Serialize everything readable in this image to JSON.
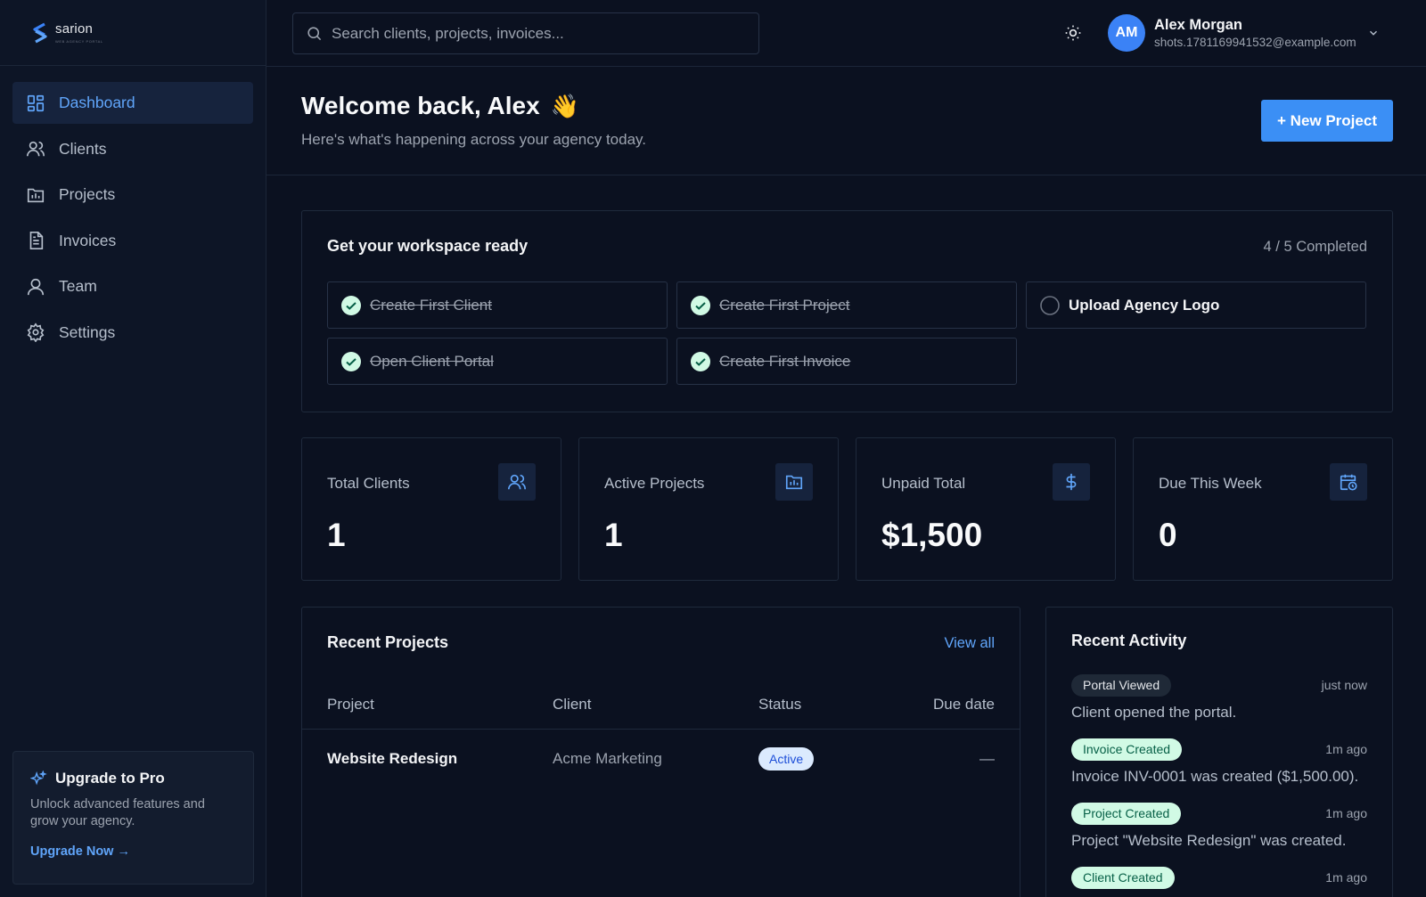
{
  "brand": {
    "name": "sarion",
    "tagline": "WEB AGENCY PORTAL",
    "accent": "#3b82f6"
  },
  "sidebar": {
    "items": [
      {
        "label": "Dashboard",
        "icon": "dashboard-icon",
        "active": true
      },
      {
        "label": "Clients",
        "icon": "users-icon"
      },
      {
        "label": "Projects",
        "icon": "folder-icon"
      },
      {
        "label": "Invoices",
        "icon": "file-text-icon"
      },
      {
        "label": "Team",
        "icon": "user-icon"
      },
      {
        "label": "Settings",
        "icon": "gear-icon"
      }
    ],
    "upgrade": {
      "title": "Upgrade to Pro",
      "description": "Unlock advanced features and grow your agency.",
      "link": "Upgrade Now →"
    }
  },
  "topbar": {
    "search_placeholder": "Search clients, projects, invoices...",
    "user": {
      "initials": "AM",
      "name": "Alex Morgan",
      "email": "shots.1781169941532@example.com"
    }
  },
  "header": {
    "title": "Welcome back, Alex",
    "emoji": "👋",
    "subtitle": "Here's what's happening across your agency today.",
    "new_project_label": "+ New Project"
  },
  "workspace": {
    "title": "Get your workspace ready",
    "progress": "4 / 5 Completed",
    "tasks": [
      {
        "label": "Create First Client",
        "done": true
      },
      {
        "label": "Create First Project",
        "done": true
      },
      {
        "label": "Upload Agency Logo",
        "done": false
      },
      {
        "label": "Open Client Portal",
        "done": true
      },
      {
        "label": "Create First Invoice",
        "done": true
      }
    ]
  },
  "stats": [
    {
      "label": "Total Clients",
      "value": "1",
      "icon": "users-icon"
    },
    {
      "label": "Active Projects",
      "value": "1",
      "icon": "folder-icon"
    },
    {
      "label": "Unpaid Total",
      "value": "$1,500",
      "icon": "dollar-icon"
    },
    {
      "label": "Due This Week",
      "value": "0",
      "icon": "calendar-clock-icon"
    }
  ],
  "recent_projects": {
    "title": "Recent Projects",
    "view_all": "View all",
    "columns": [
      "Project",
      "Client",
      "Status",
      "Due date"
    ],
    "rows": [
      {
        "project": "Website Redesign",
        "client": "Acme Marketing",
        "status": "Active",
        "due": "—"
      }
    ]
  },
  "recent_activity": {
    "title": "Recent Activity",
    "items": [
      {
        "badge": "Portal Viewed",
        "tone": "grey",
        "time": "just now",
        "text": "Client opened the portal."
      },
      {
        "badge": "Invoice Created",
        "tone": "green",
        "time": "1m ago",
        "text": "Invoice INV-0001 was created ($1,500.00)."
      },
      {
        "badge": "Project Created",
        "tone": "green",
        "time": "1m ago",
        "text": "Project \"Website Redesign\" was created."
      },
      {
        "badge": "Client Created",
        "tone": "green",
        "time": "1m ago",
        "text": ""
      }
    ]
  }
}
